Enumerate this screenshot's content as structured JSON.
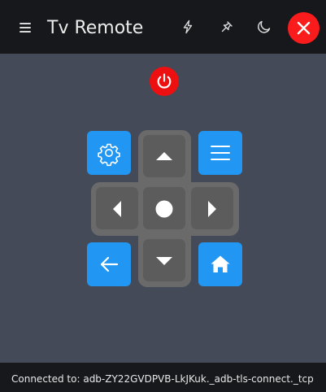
{
  "header": {
    "title": "Tv Remote",
    "icons": [
      "menu-icon",
      "flash-icon",
      "pin-icon",
      "moon-icon",
      "close-icon"
    ]
  },
  "remote": {
    "power_icon": "power-icon",
    "settings_icon": "gear-icon",
    "menu_icon": "menu-icon",
    "back_icon": "arrow-left-icon",
    "home_icon": "home-icon",
    "accent_blue": "#2196f3",
    "power_red": "#ee1010"
  },
  "status": {
    "text": "Connected to: adb-ZY22GVDPVB-LkJKuk._adb-tls-connect._tcp"
  }
}
